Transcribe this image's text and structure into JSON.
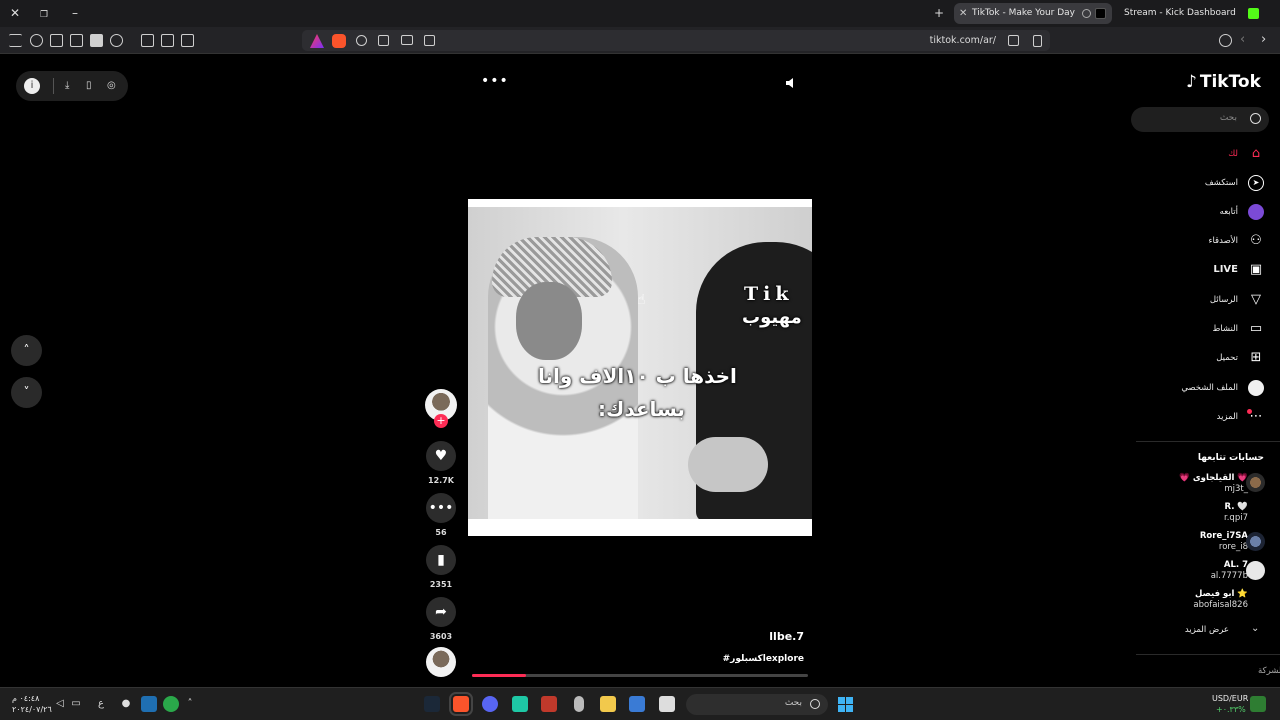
{
  "browser": {
    "tabs": [
      {
        "title": "TikTok - Make Your Day",
        "active": true
      },
      {
        "title": "Stream - Kick Dashboard",
        "active": false
      }
    ],
    "new_tab_symbol": "+",
    "url": "tiktok.com/ar/"
  },
  "player": {
    "more_symbol": "•••",
    "overlay_tik": "Tik",
    "overlay_name": "مهيوب",
    "overlay_line1": "اخذها ب ١٠الاف وانا",
    "overlay_line2": "بساعدك:",
    "author": "llbe.7",
    "hashtag": "#اكسبلورexplore",
    "progress_fraction": 0.16,
    "nav_up": "˄",
    "nav_down": "˅"
  },
  "actions": {
    "follow_symbol": "+",
    "likes": "12.7K",
    "comments": "56",
    "saves": "2351",
    "shares": "3603"
  },
  "sidebar": {
    "logo": "TikTok",
    "search_placeholder": "بحث",
    "nav": [
      {
        "label": "لك",
        "icon": "home-icon"
      },
      {
        "label": "استكشف",
        "icon": "compass-icon"
      },
      {
        "label": "أتابعه",
        "icon": "following-avatar-icon"
      },
      {
        "label": "الأصدقاء",
        "icon": "friends-icon"
      },
      {
        "label": "LIVE",
        "icon": "live-tv-icon"
      },
      {
        "label": "الرسائل",
        "icon": "send-icon"
      },
      {
        "label": "النشاط",
        "icon": "activity-icon"
      },
      {
        "label": "تحميل",
        "icon": "upload-icon"
      },
      {
        "label": "الملف الشخصي",
        "icon": "profile-icon"
      },
      {
        "label": "المزيد",
        "icon": "more-icon"
      }
    ],
    "following_title": "حسابات تتابعها",
    "following": [
      {
        "name": "💗 القيلجاوى 💗",
        "user": "mj3t_"
      },
      {
        "name": "R. 🤍",
        "user": "r.qpi7"
      },
      {
        "name": "Rore_i7SA",
        "user": "rore_i8"
      },
      {
        "name": "AL. 7",
        "user": "al.7777b"
      },
      {
        "name": "ابو فيصل ⭐",
        "user": "abofaisal826"
      }
    ],
    "show_more": "عرض المزيد",
    "company": "الشركة"
  },
  "taskbar": {
    "time": "٠٤:٤٨ م",
    "date": "٢٠٢٤/٠٧/٢٦",
    "search_placeholder": "بحث",
    "currency": "USD/EUR",
    "currency_change": "+٠.٣٣%",
    "lang": "ع"
  },
  "colors": {
    "accent": "#fe2c55",
    "background": "#000000",
    "chrome": "#232326"
  }
}
